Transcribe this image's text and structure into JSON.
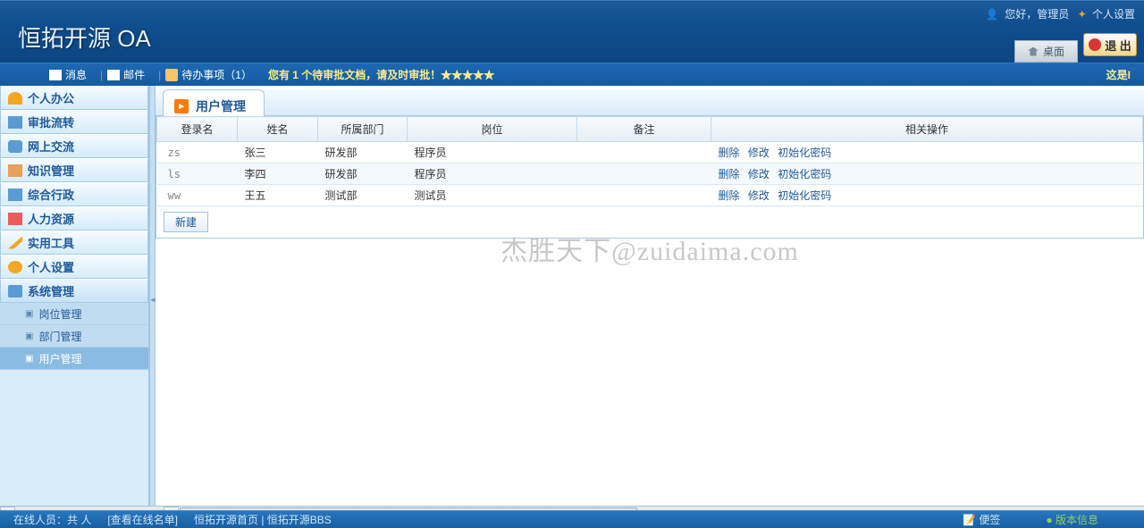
{
  "header": {
    "logo": "恒拓开源 OA",
    "greeting": "您好，管理员",
    "settings_link": "个人设置",
    "desktop_tab": "桌面",
    "exit_btn": "退 出"
  },
  "toolbar": {
    "msg": "消息",
    "mail": "邮件",
    "todo": "待办事项（1）",
    "notice": "您有 1 个待审批文档，请及时审批！★★★★★",
    "right_text": "这是I"
  },
  "sidebar": {
    "items": [
      {
        "label": "个人办公"
      },
      {
        "label": "审批流转"
      },
      {
        "label": "网上交流"
      },
      {
        "label": "知识管理"
      },
      {
        "label": "综合行政"
      },
      {
        "label": "人力资源"
      },
      {
        "label": "实用工具"
      },
      {
        "label": "个人设置"
      },
      {
        "label": "系统管理"
      }
    ],
    "submenu": [
      {
        "label": "岗位管理"
      },
      {
        "label": "部门管理"
      },
      {
        "label": "用户管理"
      }
    ]
  },
  "content": {
    "title": "用户管理",
    "columns": [
      "登录名",
      "姓名",
      "所属部门",
      "岗位",
      "备注",
      "相关操作"
    ],
    "rows": [
      {
        "login": "zs",
        "name": "张三",
        "dept": "研发部",
        "post": "程序员",
        "remark": ""
      },
      {
        "login": "ls",
        "name": "李四",
        "dept": "研发部",
        "post": "程序员",
        "remark": ""
      },
      {
        "login": "ww",
        "name": "王五",
        "dept": "测试部",
        "post": "测试员",
        "remark": ""
      }
    ],
    "actions": {
      "delete": "删除",
      "edit": "修改",
      "reset": "初始化密码"
    },
    "new_btn": "新建",
    "watermark": "杰胜天下@zuidaima.com"
  },
  "footer": {
    "online": "在线人员：共 人",
    "view_list": "[查看在线名单]",
    "links": "恒拓开源首页 | 恒拓开源BBS",
    "note": "便签",
    "version": "版本信息"
  }
}
